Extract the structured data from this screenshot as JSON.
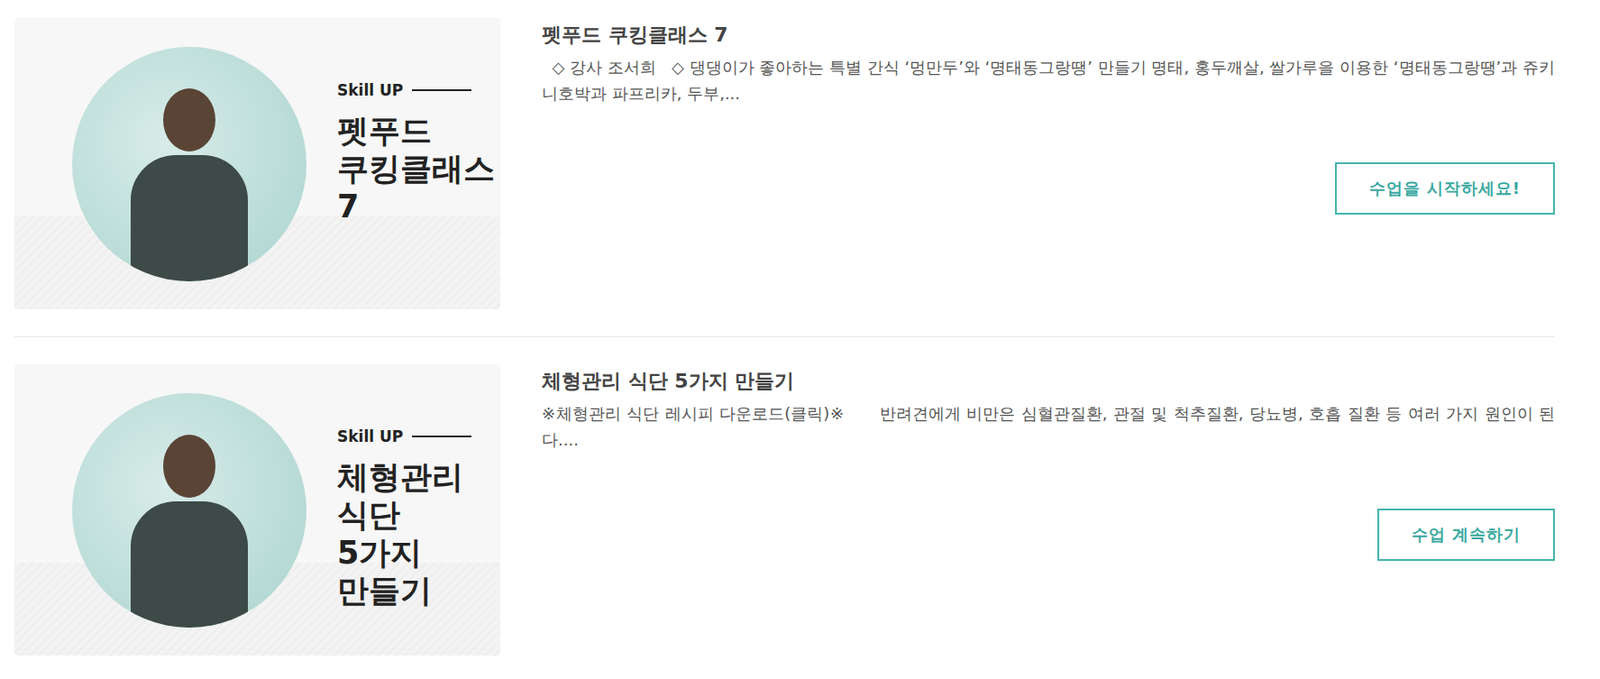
{
  "courses": [
    {
      "thumbnail": {
        "tag": "Skill UP",
        "lines": [
          "펫푸드",
          "쿠킹클래스7"
        ]
      },
      "title": "펫푸드 쿠킹클래스 7",
      "description": "  ◇ 강사 조서희   ◇ 댕댕이가 좋아하는 특별 간식 ‘멍만두’와 ‘명태동그랑땡’ 만들기 명태, 홍두깨살, 쌀가루을 이용한 ‘명태동그랑땡’과 쥬키니호박과 파프리카, 두부,...",
      "button": "수업을 시작하세요!"
    },
    {
      "thumbnail": {
        "tag": "Skill UP",
        "lines": [
          "체형관리",
          "식단",
          "5가지",
          "만들기"
        ]
      },
      "title": "체형관리 식단 5가지 만들기",
      "description": "※체형관리 식단 레시피 다운로드(클릭)※      반려견에게 비만은 심혈관질환, 관절 및 척추질환, 당뇨병, 호흡 질환 등 여러 가지 원인이 된다....",
      "button": "수업 계속하기"
    }
  ]
}
